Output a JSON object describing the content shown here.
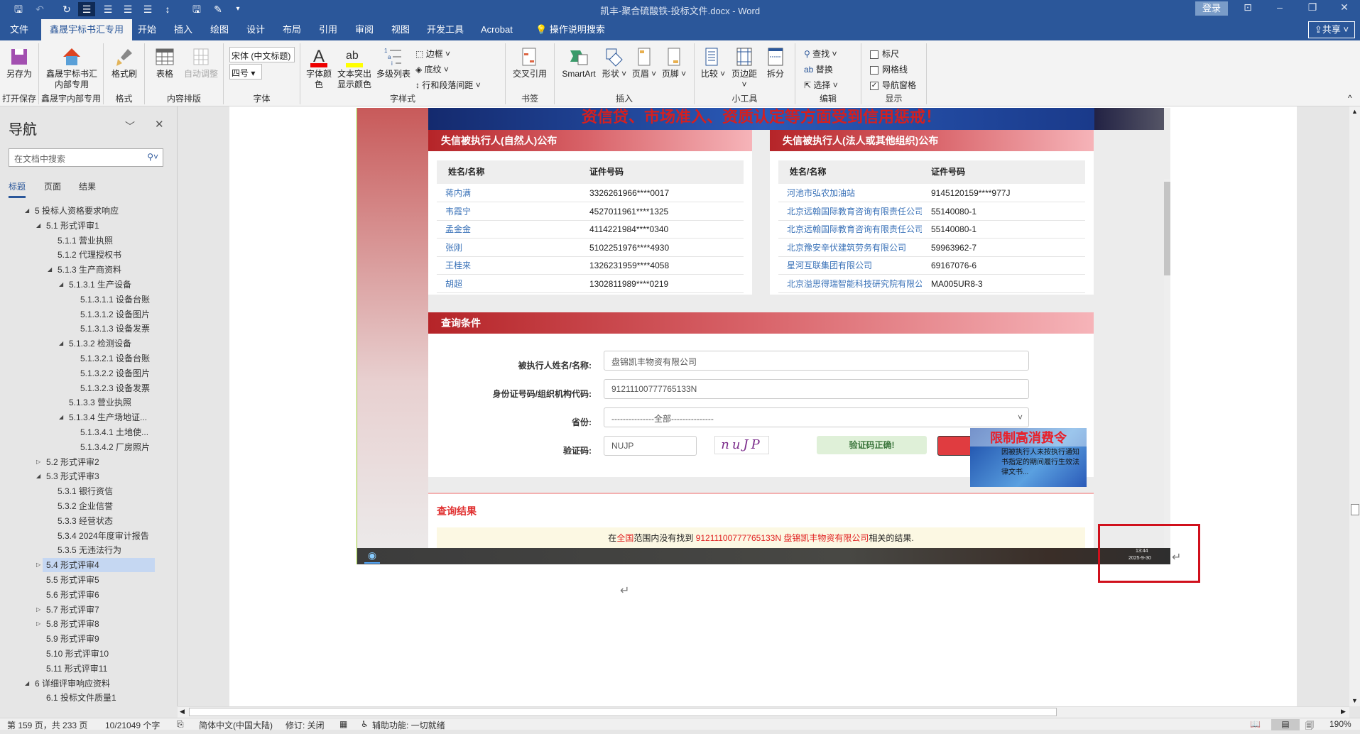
{
  "titlebar": {
    "title": "凯丰-聚合硫酸铁-投标文件.docx  -  Word",
    "login": "登录",
    "share": "共享"
  },
  "tabs": [
    "文件",
    "鑫晟宇标书汇专用",
    "开始",
    "插入",
    "绘图",
    "设计",
    "布局",
    "引用",
    "审阅",
    "视图",
    "开发工具",
    "Acrobat",
    "操作说明搜索"
  ],
  "ribbon": {
    "groups": [
      "打开保存",
      "鑫晟宇内部专用",
      "格式",
      "内容排版",
      "字体",
      "字样式",
      "书签",
      "插入",
      "小工具",
      "编辑",
      "显示"
    ],
    "save_as": "另存为",
    "xsy": "鑫晟宇标书汇内部专用",
    "format_painter": "格式刷",
    "table": "表格",
    "auto_adjust": "自动调整",
    "font_name": "宋体 (中文标题)",
    "font_size": "四号",
    "font_color": "字体颜色",
    "highlight": "文本突出显示颜色",
    "multilevel": "多级列表",
    "border": "边框",
    "shading": "底纹",
    "spacing": "行和段落间距",
    "cross_ref": "交叉引用",
    "smartart": "SmartArt",
    "shapes": "形状",
    "header": "页眉",
    "footer": "页脚",
    "compare": "比较",
    "margins": "页边距",
    "split": "拆分",
    "find": "查找",
    "replace": "替换",
    "select": "选择",
    "ruler": "标尺",
    "gridlines": "网格线",
    "nav_pane": "导航窗格",
    "ruler_checked": false,
    "grid_checked": false,
    "nav_checked": true
  },
  "nav": {
    "title": "导航",
    "search_placeholder": "在文档中搜索",
    "tabs": [
      "标题",
      "页面",
      "结果"
    ],
    "items": [
      {
        "t": "5 投标人资格要求响应",
        "l": 0,
        "s": "open"
      },
      {
        "t": "5.1 形式评审1",
        "l": 1,
        "s": "open"
      },
      {
        "t": "5.1.1 营业执照",
        "l": 2
      },
      {
        "t": "5.1.2 代理授权书",
        "l": 2
      },
      {
        "t": "5.1.3 生产商资料",
        "l": 2,
        "s": "open"
      },
      {
        "t": "5.1.3.1 生产设备",
        "l": 3,
        "s": "open"
      },
      {
        "t": "5.1.3.1.1 设备台账",
        "l": 4
      },
      {
        "t": "5.1.3.1.2 设备图片",
        "l": 4
      },
      {
        "t": "5.1.3.1.3 设备发票",
        "l": 4
      },
      {
        "t": "5.1.3.2 检测设备",
        "l": 3,
        "s": "open"
      },
      {
        "t": "5.1.3.2.1 设备台账",
        "l": 4
      },
      {
        "t": "5.1.3.2.2 设备图片",
        "l": 4
      },
      {
        "t": "5.1.3.2.3 设备发票",
        "l": 4
      },
      {
        "t": "5.1.3.3 营业执照",
        "l": 3
      },
      {
        "t": "5.1.3.4 生产场地证...",
        "l": 3,
        "s": "open"
      },
      {
        "t": "5.1.3.4.1 土地使...",
        "l": 4
      },
      {
        "t": "5.1.3.4.2 厂房照片",
        "l": 4
      },
      {
        "t": "5.2 形式评审2",
        "l": 1,
        "s": "closed"
      },
      {
        "t": "5.3 形式评审3",
        "l": 1,
        "s": "open"
      },
      {
        "t": "5.3.1 银行资信",
        "l": 2
      },
      {
        "t": "5.3.2 企业信誉",
        "l": 2
      },
      {
        "t": "5.3.3 经营状态",
        "l": 2
      },
      {
        "t": "5.3.4 2024年度审计报告",
        "l": 2
      },
      {
        "t": "5.3.5 无违法行为",
        "l": 2
      },
      {
        "t": "5.4 形式评审4",
        "l": 1,
        "s": "closed",
        "sel": true
      },
      {
        "t": "5.5 形式评审5",
        "l": 1
      },
      {
        "t": "5.6 形式评审6",
        "l": 1
      },
      {
        "t": "5.7 形式评审7",
        "l": 1,
        "s": "closed"
      },
      {
        "t": "5.8 形式评审8",
        "l": 1,
        "s": "closed"
      },
      {
        "t": "5.9 形式评审9",
        "l": 1
      },
      {
        "t": "5.10 形式评审10",
        "l": 1
      },
      {
        "t": "5.11 形式评审11",
        "l": 1
      },
      {
        "t": "6 详细评审响应资料",
        "l": 0,
        "s": "open"
      },
      {
        "t": "6.1 投标文件质量1",
        "l": 1
      }
    ]
  },
  "web": {
    "banner": "资信贷、市场准入、资质认定等方面受到信用惩戒！",
    "natural": {
      "title": "失信被执行人(自然人)公布",
      "cols": [
        "姓名/名称",
        "证件号码"
      ],
      "rows": [
        [
          "蒋内满",
          "3326261966****0017"
        ],
        [
          "韦霞宁",
          "4527011961****1325"
        ],
        [
          "孟金金",
          "4114221984****0340"
        ],
        [
          "张刚",
          "5102251976****4930"
        ],
        [
          "王桂来",
          "1326231959****4058"
        ],
        [
          "胡超",
          "1302811989****0219"
        ]
      ]
    },
    "legal": {
      "title": "失信被执行人(法人或其他组织)公布",
      "cols": [
        "姓名/名称",
        "证件号码"
      ],
      "rows": [
        [
          "河池市弘农加油站",
          "9145120159****977J"
        ],
        [
          "北京远翰国际教育咨询有限责任公司",
          "55140080-1"
        ],
        [
          "北京远翰国际教育咨询有限责任公司",
          "55140080-1"
        ],
        [
          "北京豫安辛伏建筑劳务有限公司",
          "59963962-7"
        ],
        [
          "星河互联集团有限公司",
          "69167076-6"
        ],
        [
          "北京溢思得瑞智能科技研究院有限公",
          "MA005UR8-3"
        ]
      ]
    },
    "query": {
      "title": "查询条件",
      "name_label": "被执行人姓名/名称:",
      "name_value": "盘锦凯丰物资有限公司",
      "id_label": "身份证号码/组织机构代码:",
      "id_value": "91211100777765133N",
      "province_label": "省份:",
      "province_value": "---------------全部---------------",
      "captcha_label": "验证码:",
      "captcha_value": "NUJP",
      "captcha_image": "nuJP",
      "captcha_ok": "验证码正确!",
      "ad_title": "限制高消费令",
      "ad_text": "因被执行人未按执行通知书指定的期间履行生效法律文书..."
    },
    "result": {
      "title": "查询结果",
      "p1": "在",
      "p2": "全国",
      "p3": "范围内没有找到 ",
      "p4": "91211100777765133N 盘锦凯丰物资有限公司",
      "p5": "相关的结果."
    },
    "taskbar": {
      "time": "13:44",
      "date": "2025-9-30"
    }
  },
  "status": {
    "page": "第 159 页，共 233 页",
    "words": "10/21049 个字",
    "lang": "简体中文(中国大陆)",
    "track": "修订: 关闭",
    "access": "辅助功能: 一切就绪",
    "zoom": "190%"
  },
  "colors": {
    "word_blue": "#2b579a",
    "panel_red": "#b52428",
    "highlight_box": "#d0101c"
  }
}
